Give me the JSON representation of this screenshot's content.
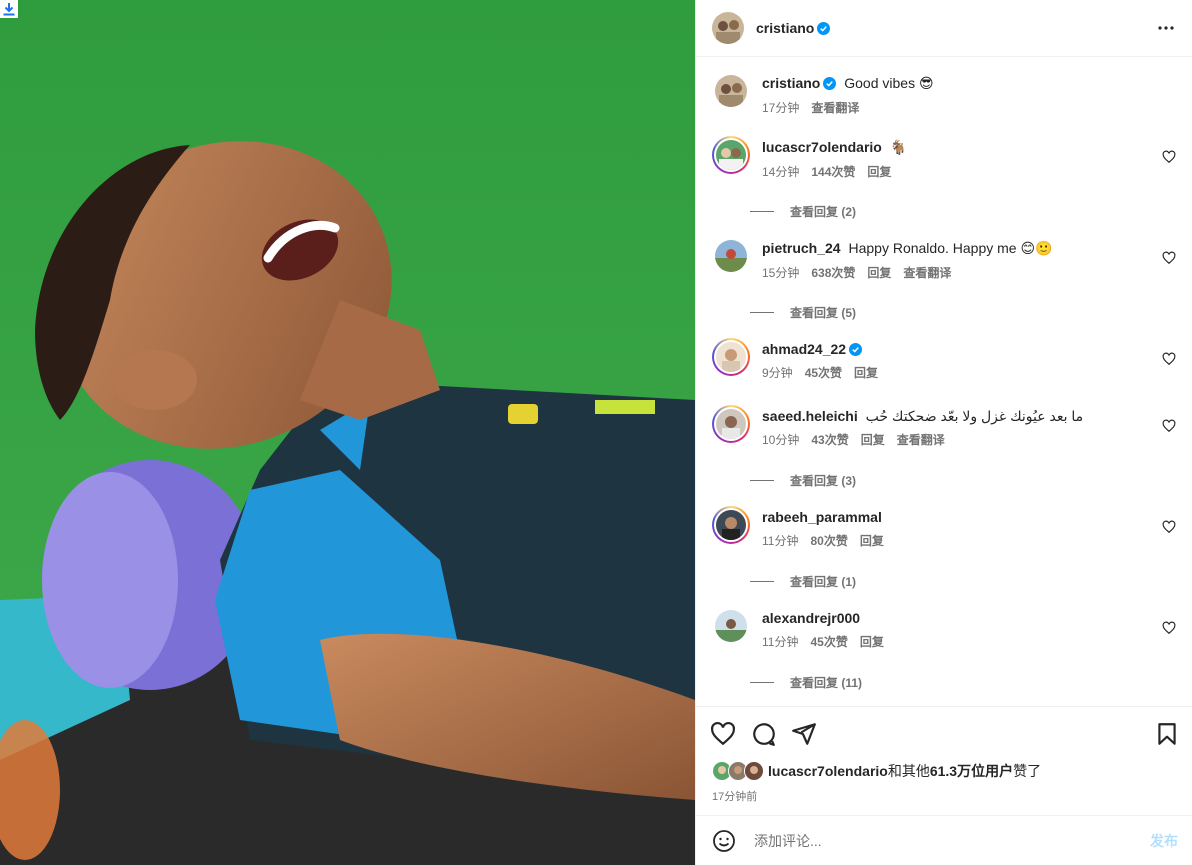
{
  "post": {
    "username": "cristiano",
    "verified": true,
    "more_icon": "more-horizontal-icon"
  },
  "caption": {
    "username": "cristiano",
    "text": "Good vibes",
    "emoji": "😎",
    "time": "17分钟",
    "translate": "查看翻译"
  },
  "comments": [
    {
      "username": "lucascr7olendario",
      "verified": false,
      "text": "",
      "emoji": "🐐",
      "time": "14分钟",
      "likes": "144次赞",
      "reply": "回复",
      "translate": "",
      "view_replies": "查看回复 (2)"
    },
    {
      "username": "pietruch_24",
      "verified": false,
      "text": "Happy Ronaldo. Happy me",
      "emoji": "😊🙂",
      "time": "15分钟",
      "likes": "638次赞",
      "reply": "回复",
      "translate": "查看翻译",
      "view_replies": "查看回复 (5)"
    },
    {
      "username": "ahmad24_22",
      "verified": true,
      "text": "",
      "emoji": "",
      "time": "9分钟",
      "likes": "45次赞",
      "reply": "回复",
      "translate": "",
      "view_replies": ""
    },
    {
      "username": "saeed.heleichi",
      "verified": false,
      "text": "ما بعد عيُونك غزل ولا بعّد ضحكتك حُب",
      "emoji": "",
      "time": "10分钟",
      "likes": "43次赞",
      "reply": "回复",
      "translate": "查看翻译",
      "view_replies": "查看回复 (3)"
    },
    {
      "username": "rabeeh_parammal",
      "verified": false,
      "text": "",
      "emoji": "",
      "time": "11分钟",
      "likes": "80次赞",
      "reply": "回复",
      "translate": "",
      "view_replies": "查看回复 (1)"
    },
    {
      "username": "alexandrejr000",
      "verified": false,
      "text": "",
      "emoji": "",
      "time": "11分钟",
      "likes": "45次赞",
      "reply": "回复",
      "translate": "",
      "view_replies": "查看回复 (11)"
    }
  ],
  "actions": {
    "like_icon": "heart-icon",
    "comment_icon": "comment-icon",
    "share_icon": "send-icon",
    "save_icon": "bookmark-icon"
  },
  "likes": {
    "user": "lucascr7olendario",
    "connector": "和其他",
    "count": "61.3万位用户",
    "suffix": "赞了"
  },
  "posted": "17分钟前",
  "composer": {
    "placeholder": "添加评论...",
    "post_label": "发布",
    "emoji_icon": "smiley-icon"
  },
  "colors": {
    "accent": "#0095f6",
    "post_disabled": "#b2dffc",
    "muted": "#737373"
  }
}
